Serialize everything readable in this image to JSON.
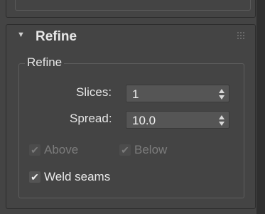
{
  "rollout": {
    "title": "Refine",
    "collapse_icon": "collapse-arrow-icon",
    "grip_icon": "drag-grip-icon"
  },
  "group": {
    "label": "Refine",
    "slices": {
      "label": "Slices:",
      "value": "1"
    },
    "spread": {
      "label": "Spread:",
      "value": "10.0"
    },
    "above": {
      "label": "Above",
      "checked": true,
      "enabled": false
    },
    "below": {
      "label": "Below",
      "checked": true,
      "enabled": false
    },
    "weld_seams": {
      "label": "Weld seams",
      "checked": true,
      "enabled": true
    }
  },
  "glyphs": {
    "arrow": "▼",
    "check": "✔"
  }
}
